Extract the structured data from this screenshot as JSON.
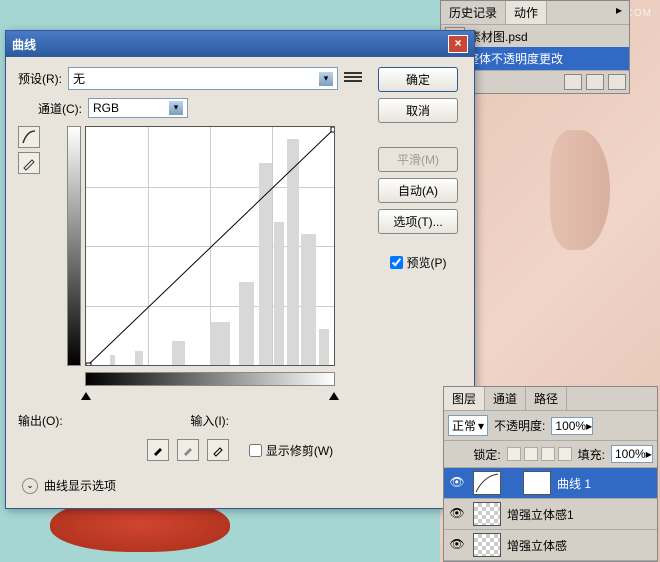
{
  "watermark": "WWW.MISSYUAN.COM",
  "history": {
    "tabs": [
      "历史记录",
      "动作"
    ],
    "filename": "素材图.psd",
    "selected_item": "整体不透明度更改"
  },
  "dialog": {
    "title": "曲线",
    "preset_label": "预设(R):",
    "preset_value": "无",
    "channel_label": "通道(C):",
    "channel_value": "RGB",
    "output_label": "输出(O):",
    "input_label": "输入(I):",
    "show_clip_label": "显示修剪(W)",
    "display_options": "曲线显示选项",
    "buttons": {
      "ok": "确定",
      "cancel": "取消",
      "smooth": "平滑(M)",
      "auto": "自动(A)",
      "options": "选项(T)...",
      "preview": "预览(P)"
    }
  },
  "layers": {
    "tabs": [
      "图层",
      "通道",
      "路径"
    ],
    "blend": "正常",
    "opacity_label": "不透明度:",
    "opacity_value": "100%",
    "lock_label": "锁定:",
    "fill_label": "填充:",
    "fill_value": "100%",
    "items": [
      {
        "name": "曲线 1",
        "active": true
      },
      {
        "name": "增强立体感1",
        "active": false
      },
      {
        "name": "增强立体感",
        "active": false
      }
    ]
  },
  "chart_data": {
    "type": "line",
    "title": "曲线 (Curves)",
    "xlabel": "输入",
    "ylabel": "输出",
    "xlim": [
      0,
      255
    ],
    "ylim": [
      0,
      255
    ],
    "series": [
      {
        "name": "RGB",
        "x": [
          0,
          255
        ],
        "y": [
          0,
          255
        ]
      }
    ],
    "histogram_hint": "right-skewed, large peak near 200-240"
  }
}
